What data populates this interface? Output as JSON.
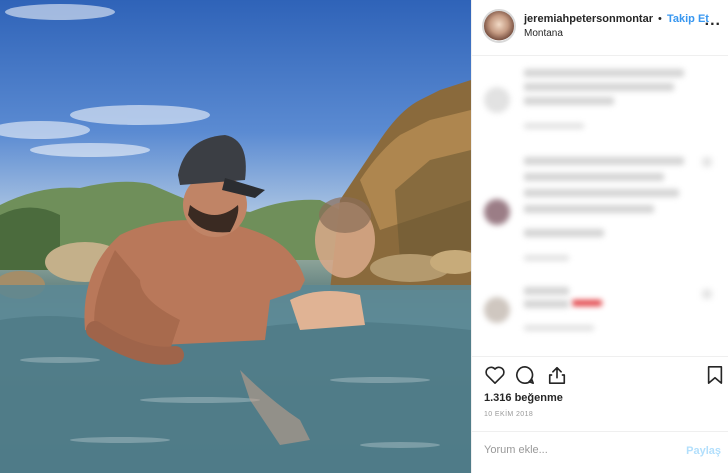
{
  "header": {
    "username": "jeremiahpetersonmontar",
    "separator": "•",
    "follow_label": "Takip Et",
    "location": "Montana",
    "more_label": "..."
  },
  "icons": {
    "like": "heart-icon",
    "comment": "comment-bubble-icon",
    "share": "share-icon",
    "save": "bookmark-icon",
    "more": "more-options-icon"
  },
  "post": {
    "likes_text": "1.316 beğenme",
    "date_text": "10 EKİM 2018"
  },
  "comment_box": {
    "placeholder": "Yorum ekle...",
    "post_label": "Paylaş"
  },
  "colors": {
    "accent": "#3897f0",
    "post_disabled": "#b2dffc",
    "text": "#262626",
    "muted": "#999999",
    "blur_highlight": "#e0393e"
  }
}
